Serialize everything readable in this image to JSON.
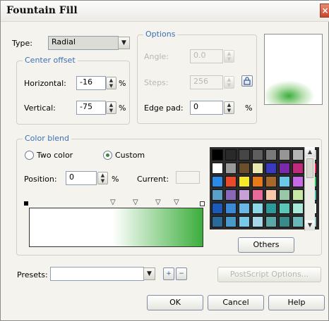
{
  "window": {
    "title": "Fountain Fill",
    "close_glyph": "×"
  },
  "type_field": {
    "label": "Type:",
    "value": "Radial",
    "arrow": "▼"
  },
  "center_offset": {
    "legend": "Center offset",
    "horizontal": {
      "label": "Horizontal:",
      "value": "-16",
      "unit": "%"
    },
    "vertical": {
      "label": "Vertical:",
      "value": "-75",
      "unit": "%"
    }
  },
  "options": {
    "legend": "Options",
    "angle": {
      "label": "Angle:",
      "value": "0.0"
    },
    "steps": {
      "label": "Steps:",
      "value": "256"
    },
    "edge_pad": {
      "label": "Edge pad:",
      "value": "0",
      "unit": "%"
    }
  },
  "color_blend": {
    "legend": "Color blend",
    "two_color": {
      "label": "Two color",
      "checked": false
    },
    "custom": {
      "label": "Custom",
      "checked": true
    },
    "position": {
      "label": "Position:",
      "value": "0",
      "unit": "%"
    },
    "current_label": "Current:",
    "gradient": {
      "start": "#ffffff",
      "end": "#3cae3c"
    },
    "marker_glyph": "▽",
    "palette_colors": [
      "#000000",
      "#2a2a2a",
      "#464646",
      "#5e5e5e",
      "#7a7a7a",
      "#969696",
      "#b4b4b4",
      "#d0d0d0",
      "#ffffff",
      "#9a9a9a",
      "#6b4f2a",
      "#e8e8b0",
      "#3a3ac0",
      "#7a2aa8",
      "#c02a7a",
      "#e62a5a",
      "#2a8ae8",
      "#e84a2a",
      "#f8e82a",
      "#e87a1a",
      "#a8682a",
      "#6ac8e8",
      "#c86ae8",
      "#2ab85a",
      "#5aa0c8",
      "#8a68b8",
      "#c8a0d8",
      "#e86a9a",
      "#f8c8a8",
      "#98c8a8",
      "#c8e8a8",
      "#48b8a8",
      "#1a5ab8",
      "#3a8ad8",
      "#6ab8e8",
      "#8ad8e8",
      "#2a9a9a",
      "#5ac8b8",
      "#a8e8d8",
      "#e8f8e8",
      "#2a6a9a",
      "#4a9ac8",
      "#7ac8e8",
      "#a8d8e8",
      "#5aa8a8",
      "#3a8a8a",
      "#6ab8b8",
      "#98c8c8"
    ],
    "others_label": "Others"
  },
  "presets": {
    "label": "Presets:",
    "value": ""
  },
  "postscript_label": "PostScript Options...",
  "buttons": {
    "ok": "OK",
    "cancel": "Cancel",
    "help": "Help"
  }
}
